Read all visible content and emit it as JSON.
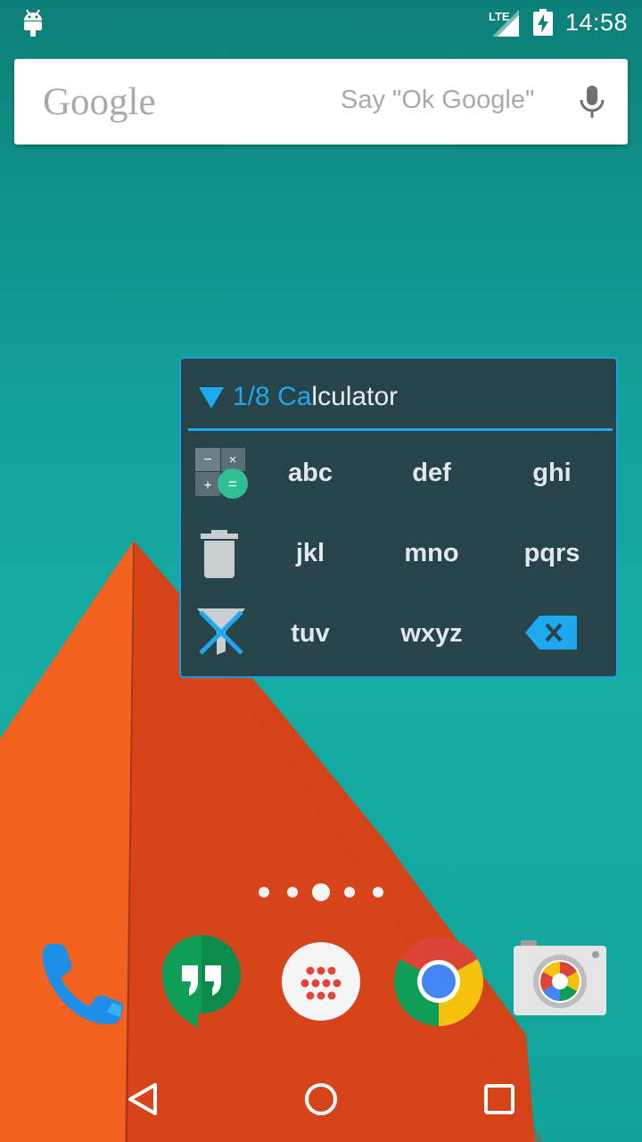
{
  "status_bar": {
    "network_type": "LTE",
    "time": "14:58"
  },
  "search": {
    "logo": "Google",
    "hint": "Say \"Ok Google\""
  },
  "widget": {
    "title_counter": "1/8",
    "title_match": "Ca",
    "title_rest": "lculator",
    "keys": [
      "abc",
      "def",
      "ghi",
      "jkl",
      "mno",
      "pqrs",
      "tuv",
      "wxyz"
    ],
    "side_icons": [
      "calculator-icon",
      "trash-icon",
      "filter-off-icon"
    ],
    "backspace_icon": "backspace-icon",
    "accent_color": "#1ea8ee",
    "background_color": "#27444a"
  },
  "home": {
    "page_count": 5,
    "current_page": 3
  },
  "dock": {
    "apps": [
      "phone-icon",
      "hangouts-icon",
      "app-drawer-icon",
      "chrome-icon",
      "camera-icon"
    ]
  },
  "nav": {
    "buttons": [
      "back-icon",
      "home-icon",
      "recents-icon"
    ]
  },
  "colors": {
    "wallpaper_teal": "#12a198",
    "wallpaper_orange": "#f1591d"
  }
}
